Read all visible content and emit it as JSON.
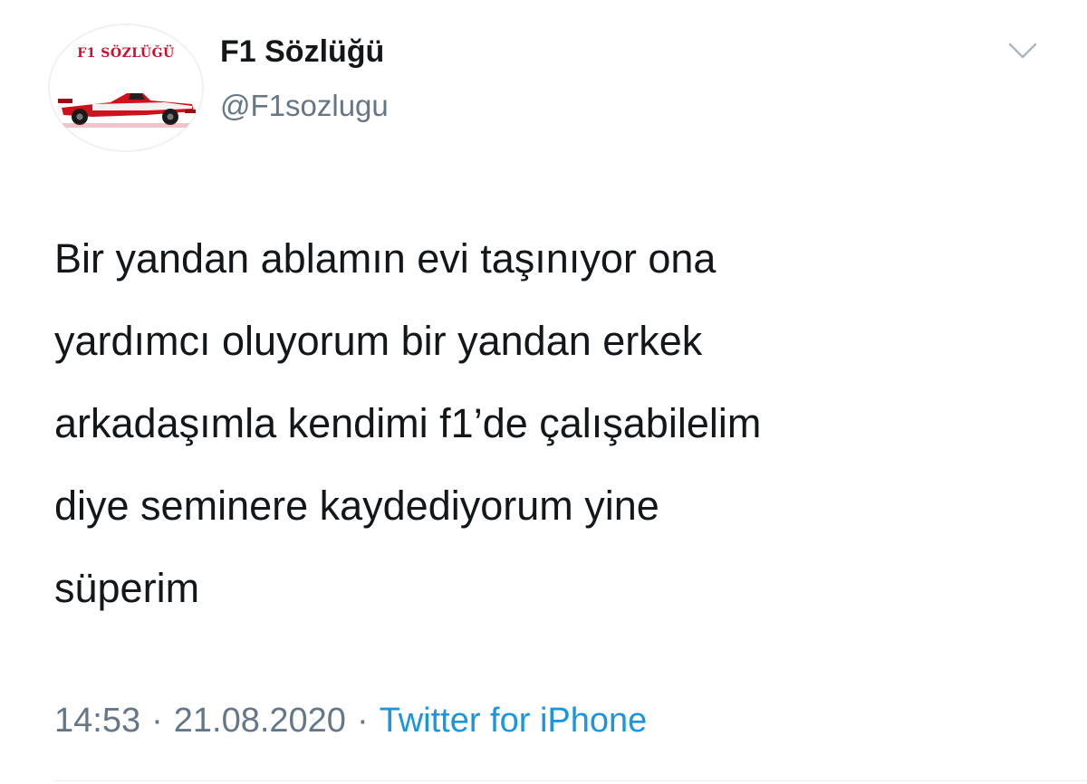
{
  "author": {
    "avatar_logo_text": "F1 SÖZLÜĞÜ",
    "display_name": "F1 Sözlüğü",
    "handle": "@F1sozlugu"
  },
  "menu": {
    "icon": "chevron-down-icon"
  },
  "tweet": {
    "text_lines": [
      "Bir yandan ablamın evi taşınıyor ona",
      "yardımcı oluyorum bir yandan erkek",
      "arkadaşımla kendimi f1’de çalışabilelim",
      "diye seminere kaydediyorum yine",
      "süperim"
    ]
  },
  "meta": {
    "time": "14:53",
    "date": "21.08.2020",
    "separator": "·",
    "source": "Twitter for iPhone"
  },
  "colors": {
    "text": "#14171a",
    "secondary": "#657786",
    "link": "#1b95e0",
    "logo_red": "#c8102e"
  }
}
